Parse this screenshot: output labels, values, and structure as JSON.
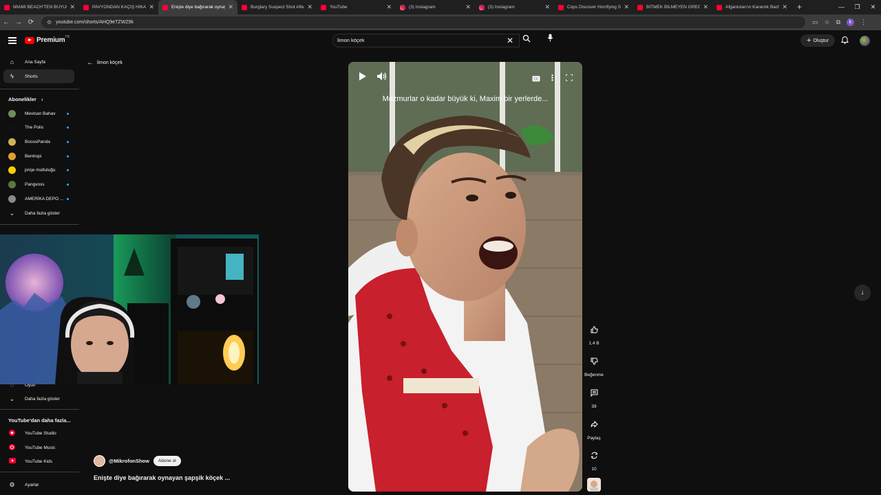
{
  "browser": {
    "tabs": [
      {
        "title": "MİAMİ BEACH'TEN BÜYÜCÜN",
        "icon": "youtube-icon",
        "active": false
      },
      {
        "title": "PAVYONDAN KAÇIŞ HİKAYESİ",
        "icon": "youtube-icon",
        "active": false
      },
      {
        "title": "Enişte diye bağırarak oynayan",
        "icon": "youtube-icon",
        "active": true
      },
      {
        "title": "Burglary Suspect Shot After C",
        "icon": "youtube-icon",
        "active": false
      },
      {
        "title": "YouTube",
        "icon": "youtube-icon",
        "active": false
      },
      {
        "title": "(3) Instagram",
        "icon": "instagram-icon",
        "active": false
      },
      {
        "title": "(3) Instagram",
        "icon": "instagram-icon",
        "active": false
      },
      {
        "title": "Cops Discover Horrifying Sec",
        "icon": "youtube-icon",
        "active": false
      },
      {
        "title": "BİTMEK BİLMEYEN GREG FLE",
        "icon": "youtube-icon",
        "active": false
      },
      {
        "title": "Afganistan'ın Karanlık Bacha",
        "icon": "youtube-icon",
        "active": false
      }
    ],
    "url": "youtube.com/shorts/AHQ9eTZWZ9k",
    "profile_initial": "k"
  },
  "header": {
    "logo_text": "Premium",
    "logo_region": "TR",
    "search_value": "limon köçek",
    "create_label": "Oluştur"
  },
  "sidebar": {
    "home_label": "Ana Sayfa",
    "shorts_label": "Shorts",
    "subscriptions_heading": "Abonelikler",
    "subscriptions": [
      {
        "name": "Mevlcan Bahav",
        "color": "#6b8e5a"
      },
      {
        "name": "The Polis",
        "color": "#111111"
      },
      {
        "name": "BoossPanda",
        "color": "#c9b458"
      },
      {
        "name": "Bentropi",
        "color": "#e0a030"
      },
      {
        "name": "proje mutluluğu",
        "color": "#f5d000"
      },
      {
        "name": "Pangvoss",
        "color": "#5a7a3a"
      },
      {
        "name": "AMERİKA DEPO ...",
        "color": "#8a8a8a"
      }
    ],
    "show_more_1": "Daha fazla göster",
    "partial_item": "Oyun",
    "show_more_2": "Daha fazla göster",
    "more_heading": "YouTube'dan daha fazla...",
    "more_items": [
      "YouTube Studio",
      "YouTube Music",
      "YouTube Kids"
    ],
    "settings_label": "Ayarlar"
  },
  "main": {
    "back_label": "limon köçek",
    "caption": "Mezmurlar o kadar büyük ki, Maxim bir yerlerde...",
    "channel_name": "@MikrofonShow",
    "subscribe_label": "Abone ol",
    "video_title": "Enişte diye bağırarak oynayan şapşik köçek ...",
    "actions": {
      "like_count": "1,4 B",
      "dislike_label": "Beğenme",
      "comment_count": "39",
      "share_label": "Paylaş",
      "remix_count": "10"
    }
  }
}
